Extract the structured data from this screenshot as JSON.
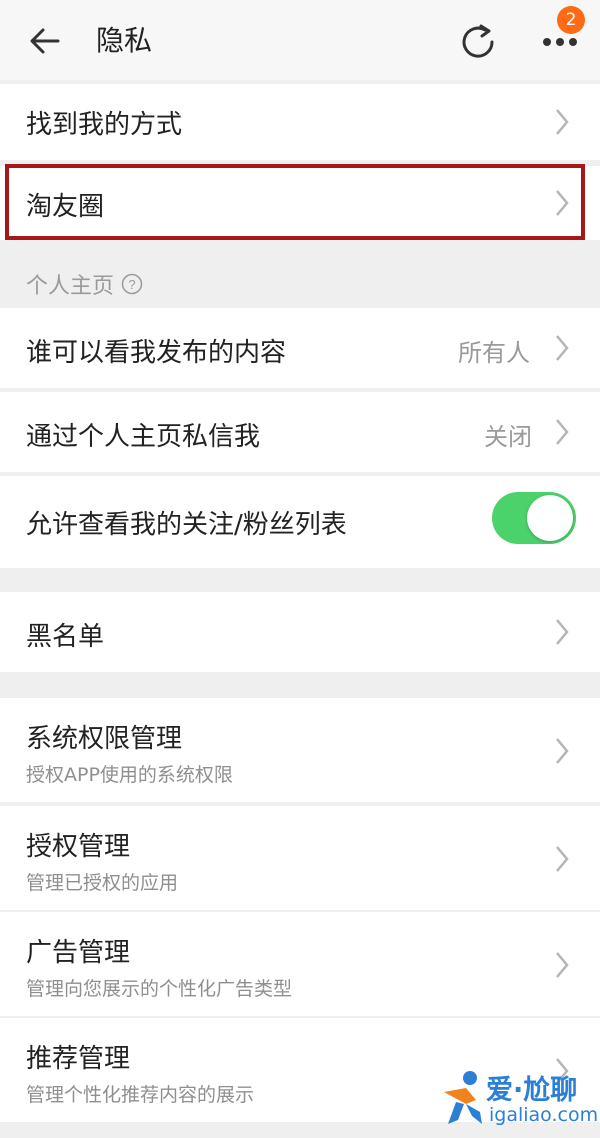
{
  "header": {
    "title": "隐私",
    "badge_count": "2",
    "icons": [
      "back-arrow-icon",
      "refresh-icon",
      "more-icon"
    ]
  },
  "rows": {
    "find_me": {
      "label": "找到我的方式"
    },
    "taoyouquan": {
      "label": "淘友圈"
    },
    "view_posts": {
      "label": "谁可以看我发布的内容",
      "value": "所有人"
    },
    "private_msg": {
      "label": "通过个人主页私信我",
      "value": "关闭"
    },
    "follow_list": {
      "label": "允许查看我的关注/粉丝列表",
      "toggle_on": true
    },
    "blacklist": {
      "label": "黑名单"
    },
    "sys_perm": {
      "label": "系统权限管理",
      "sub": "授权APP使用的系统权限"
    },
    "auth_mgmt": {
      "label": "授权管理",
      "sub": "管理已授权的应用"
    },
    "ad_mgmt": {
      "label": "广告管理",
      "sub": "管理向您展示的个性化广告类型"
    },
    "rec_mgmt": {
      "label": "推荐管理",
      "sub": "管理个性化推荐内容的展示"
    }
  },
  "section": {
    "personal_home": "个人主页"
  },
  "watermark": {
    "brand": "爱·尬聊",
    "url": "igaliao.com"
  },
  "colors": {
    "toggle_on": "#4cd26b",
    "badge": "#ff6a16",
    "highlight_border": "#a51818",
    "watermark": "#2c7fd6"
  }
}
